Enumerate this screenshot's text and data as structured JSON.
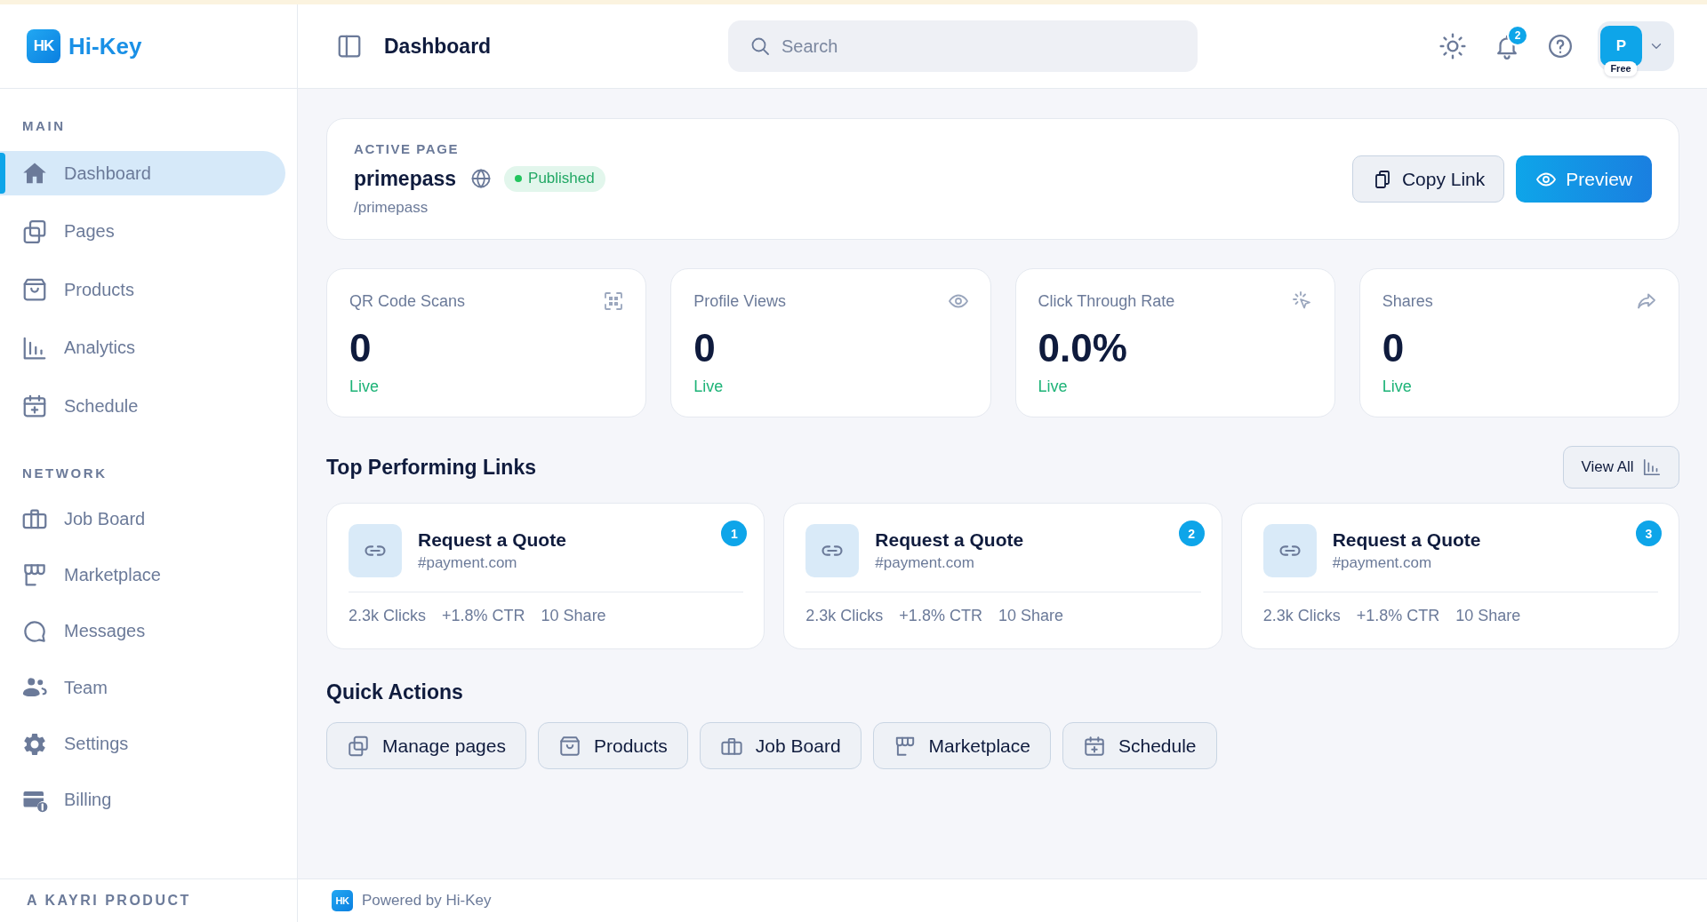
{
  "sidebar": {
    "brand": {
      "mark": "HK",
      "name": "Hi-Key"
    },
    "sections": [
      {
        "heading": "MAIN",
        "items": [
          {
            "label": "Dashboard",
            "kind": "home",
            "selected": true
          },
          {
            "label": "Pages",
            "kind": "pages",
            "selected": false
          },
          {
            "label": "Products",
            "kind": "products",
            "selected": false
          },
          {
            "label": "Analytics",
            "kind": "analytics",
            "selected": false
          },
          {
            "label": "Schedule",
            "kind": "schedule",
            "selected": false
          }
        ]
      },
      {
        "heading": "NETWORK",
        "items": [
          {
            "label": "Job Board",
            "kind": "jobboard",
            "selected": false
          },
          {
            "label": "Marketplace",
            "kind": "marketplace",
            "selected": false
          },
          {
            "label": "Messages",
            "kind": "messages",
            "selected": false
          },
          {
            "label": "Team",
            "kind": "team",
            "selected": false
          },
          {
            "label": "Settings",
            "kind": "settings",
            "selected": false
          },
          {
            "label": "Billing",
            "kind": "billing",
            "selected": false
          }
        ]
      }
    ],
    "tagline": "A KAYRI PRODUCT"
  },
  "header": {
    "title": "Dashboard",
    "search": {
      "placeholder": "Search"
    },
    "notifications": "2",
    "account": {
      "initial": "P",
      "plan": "Free"
    }
  },
  "active_page": {
    "heading": "ACTIVE PAGE",
    "name": "primepass",
    "status": "Published",
    "path": "/primepass",
    "actions": [
      {
        "label": "Copy Link",
        "kind": "copy"
      },
      {
        "label": "Preview",
        "kind": "preview"
      }
    ]
  },
  "stats": [
    {
      "label": "QR Code Scans",
      "kind": "qr",
      "value": "0",
      "status": "Live"
    },
    {
      "label": "Profile Views",
      "kind": "views",
      "value": "0",
      "status": "Live"
    },
    {
      "label": "Click Through Rate",
      "kind": "ctr",
      "value": "0.0%",
      "status": "Live"
    },
    {
      "label": "Shares",
      "kind": "shares",
      "value": "0",
      "status": "Live"
    }
  ],
  "top_links": {
    "title": "Top Performing Links",
    "view_all": "View All",
    "items": [
      {
        "rank": "1",
        "title": "Request a Quote",
        "url": "#payment.com",
        "clicks": "2.3k Clicks",
        "ctr": "+1.8% CTR",
        "shares": "10 Share"
      },
      {
        "rank": "2",
        "title": "Request a Quote",
        "url": "#payment.com",
        "clicks": "2.3k Clicks",
        "ctr": "+1.8% CTR",
        "shares": "10 Share"
      },
      {
        "rank": "3",
        "title": "Request a Quote",
        "url": "#payment.com",
        "clicks": "2.3k Clicks",
        "ctr": "+1.8% CTR",
        "shares": "10 Share"
      }
    ]
  },
  "quick_actions": {
    "title": "Quick Actions",
    "items": [
      {
        "label": "Manage pages",
        "kind": "pages"
      },
      {
        "label": "Products",
        "kind": "products"
      },
      {
        "label": "Job Board",
        "kind": "jobboard"
      },
      {
        "label": "Marketplace",
        "kind": "marketplace"
      },
      {
        "label": "Schedule",
        "kind": "schedule"
      }
    ]
  },
  "footer": {
    "mark": "HK",
    "text": "Powered by Hi-Key"
  }
}
